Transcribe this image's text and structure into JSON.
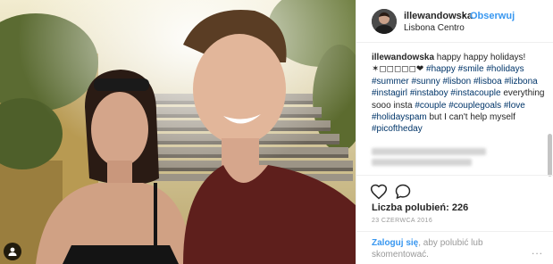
{
  "post": {
    "username": "illewandowska",
    "separator": "•",
    "follow_label": "Obserwuj",
    "location": "Lisbona Centro"
  },
  "caption": {
    "user": "illewandowska",
    "text_1": " happy happy holidays! ✶◻◻◻◻◻❤ ",
    "tag_happy": "#happy",
    "tag_smile": "#smile",
    "tag_holidays": "#holidays",
    "tag_summer": "#summer",
    "tag_sunny": "#sunny",
    "tag_lisbon": "#lisbon",
    "tag_lisboa": "#lisboa",
    "tag_lizbona": "#lizbona",
    "tag_instagirl": "#instagirl",
    "tag_instaboy": "#instaboy",
    "tag_instacouple": "#instacouple",
    "text_2": " everything sooo insta ",
    "tag_couple": "#couple",
    "tag_couplegoals": "#couplegoals",
    "tag_love": "#love",
    "tag_holidayspam": "#holidayspam",
    "text_3": " but I can't help myself ",
    "tag_picoftheday": "#picoftheday"
  },
  "actions": {
    "heart_icon": "heart-outline",
    "comment_icon": "speech-bubble",
    "likes_label": "Liczba polubień:",
    "likes_count": "226",
    "date": "23 CZERWCA 2016"
  },
  "login": {
    "link": "Zaloguj się",
    "rest": ", aby polubić lub skomentować.",
    "more": "..."
  },
  "colors": {
    "link_blue": "#3897f0",
    "hashtag": "#003569",
    "muted": "#999999",
    "text": "#262626"
  }
}
